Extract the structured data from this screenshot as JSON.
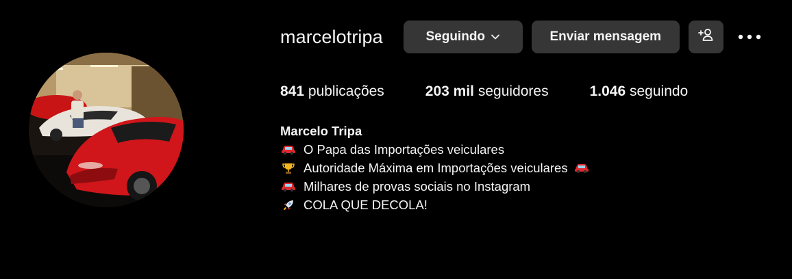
{
  "profile": {
    "username": "marcelotripa",
    "avatar_icon": "profile-photo-red-cars"
  },
  "actions": {
    "following_label": "Seguindo",
    "message_label": "Enviar mensagem",
    "suggest_icon": "person-plus-icon",
    "more_icon": "more-dots-icon"
  },
  "stats": {
    "posts_count": "841",
    "posts_label": "publicações",
    "followers_count": "203 mil",
    "followers_label": "seguidores",
    "following_count": "1.046",
    "following_label": "seguindo"
  },
  "bio": {
    "name": "Marcelo Tripa",
    "lines": [
      {
        "icon": "car-emoji",
        "text": "O Papa das Importações veiculares"
      },
      {
        "icon": "trophy-emoji",
        "text": "Autoridade Máxima em Importações veiculares",
        "trailing_icon": "car-emoji"
      },
      {
        "icon": "car-emoji",
        "text": "Milhares de provas sociais no Instagram"
      },
      {
        "icon": "rocket-emoji",
        "text": "COLA QUE DECOLA!"
      }
    ]
  },
  "colors": {
    "background": "#000000",
    "button": "#363636",
    "text": "#f5f5f5"
  }
}
